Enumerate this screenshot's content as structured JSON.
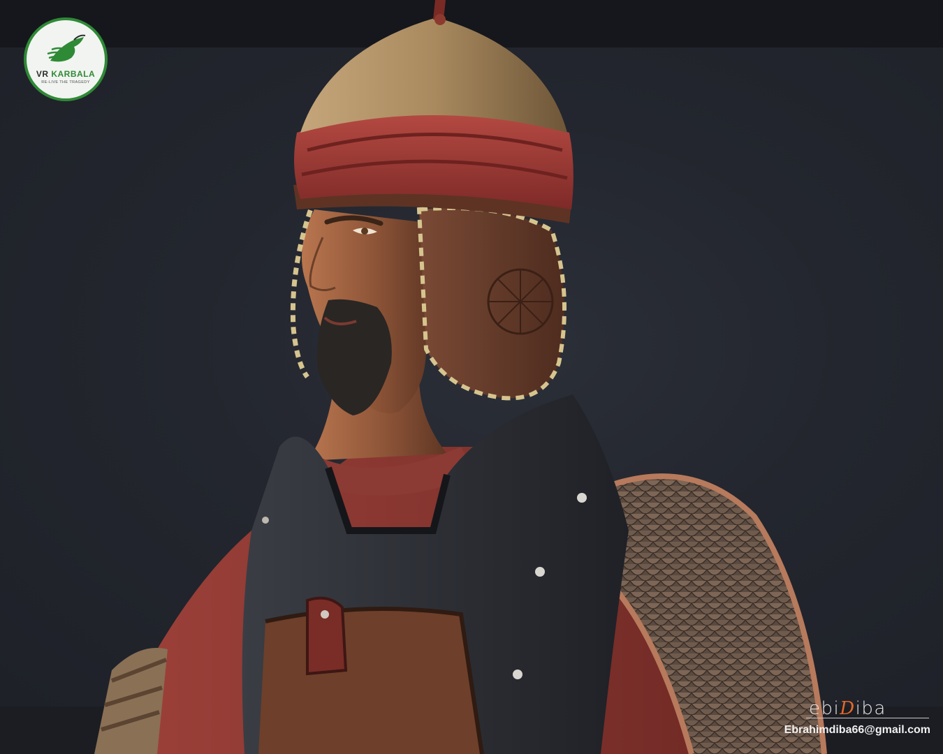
{
  "logo": {
    "brand_part1": "VR",
    "brand_part2": "KARBALA",
    "tagline": "RE-LIVE THE TRAGEDY",
    "accent_color": "#2f8a36"
  },
  "signature": {
    "prefix": "ebi",
    "initial": "D",
    "suffix": "iba",
    "accent_color": "#e06a2a"
  },
  "contact": {
    "email": "Ebrahimdiba66@gmail.com"
  },
  "render": {
    "subject": "warrior-3d-character-bust",
    "background_color": "#23262e"
  }
}
